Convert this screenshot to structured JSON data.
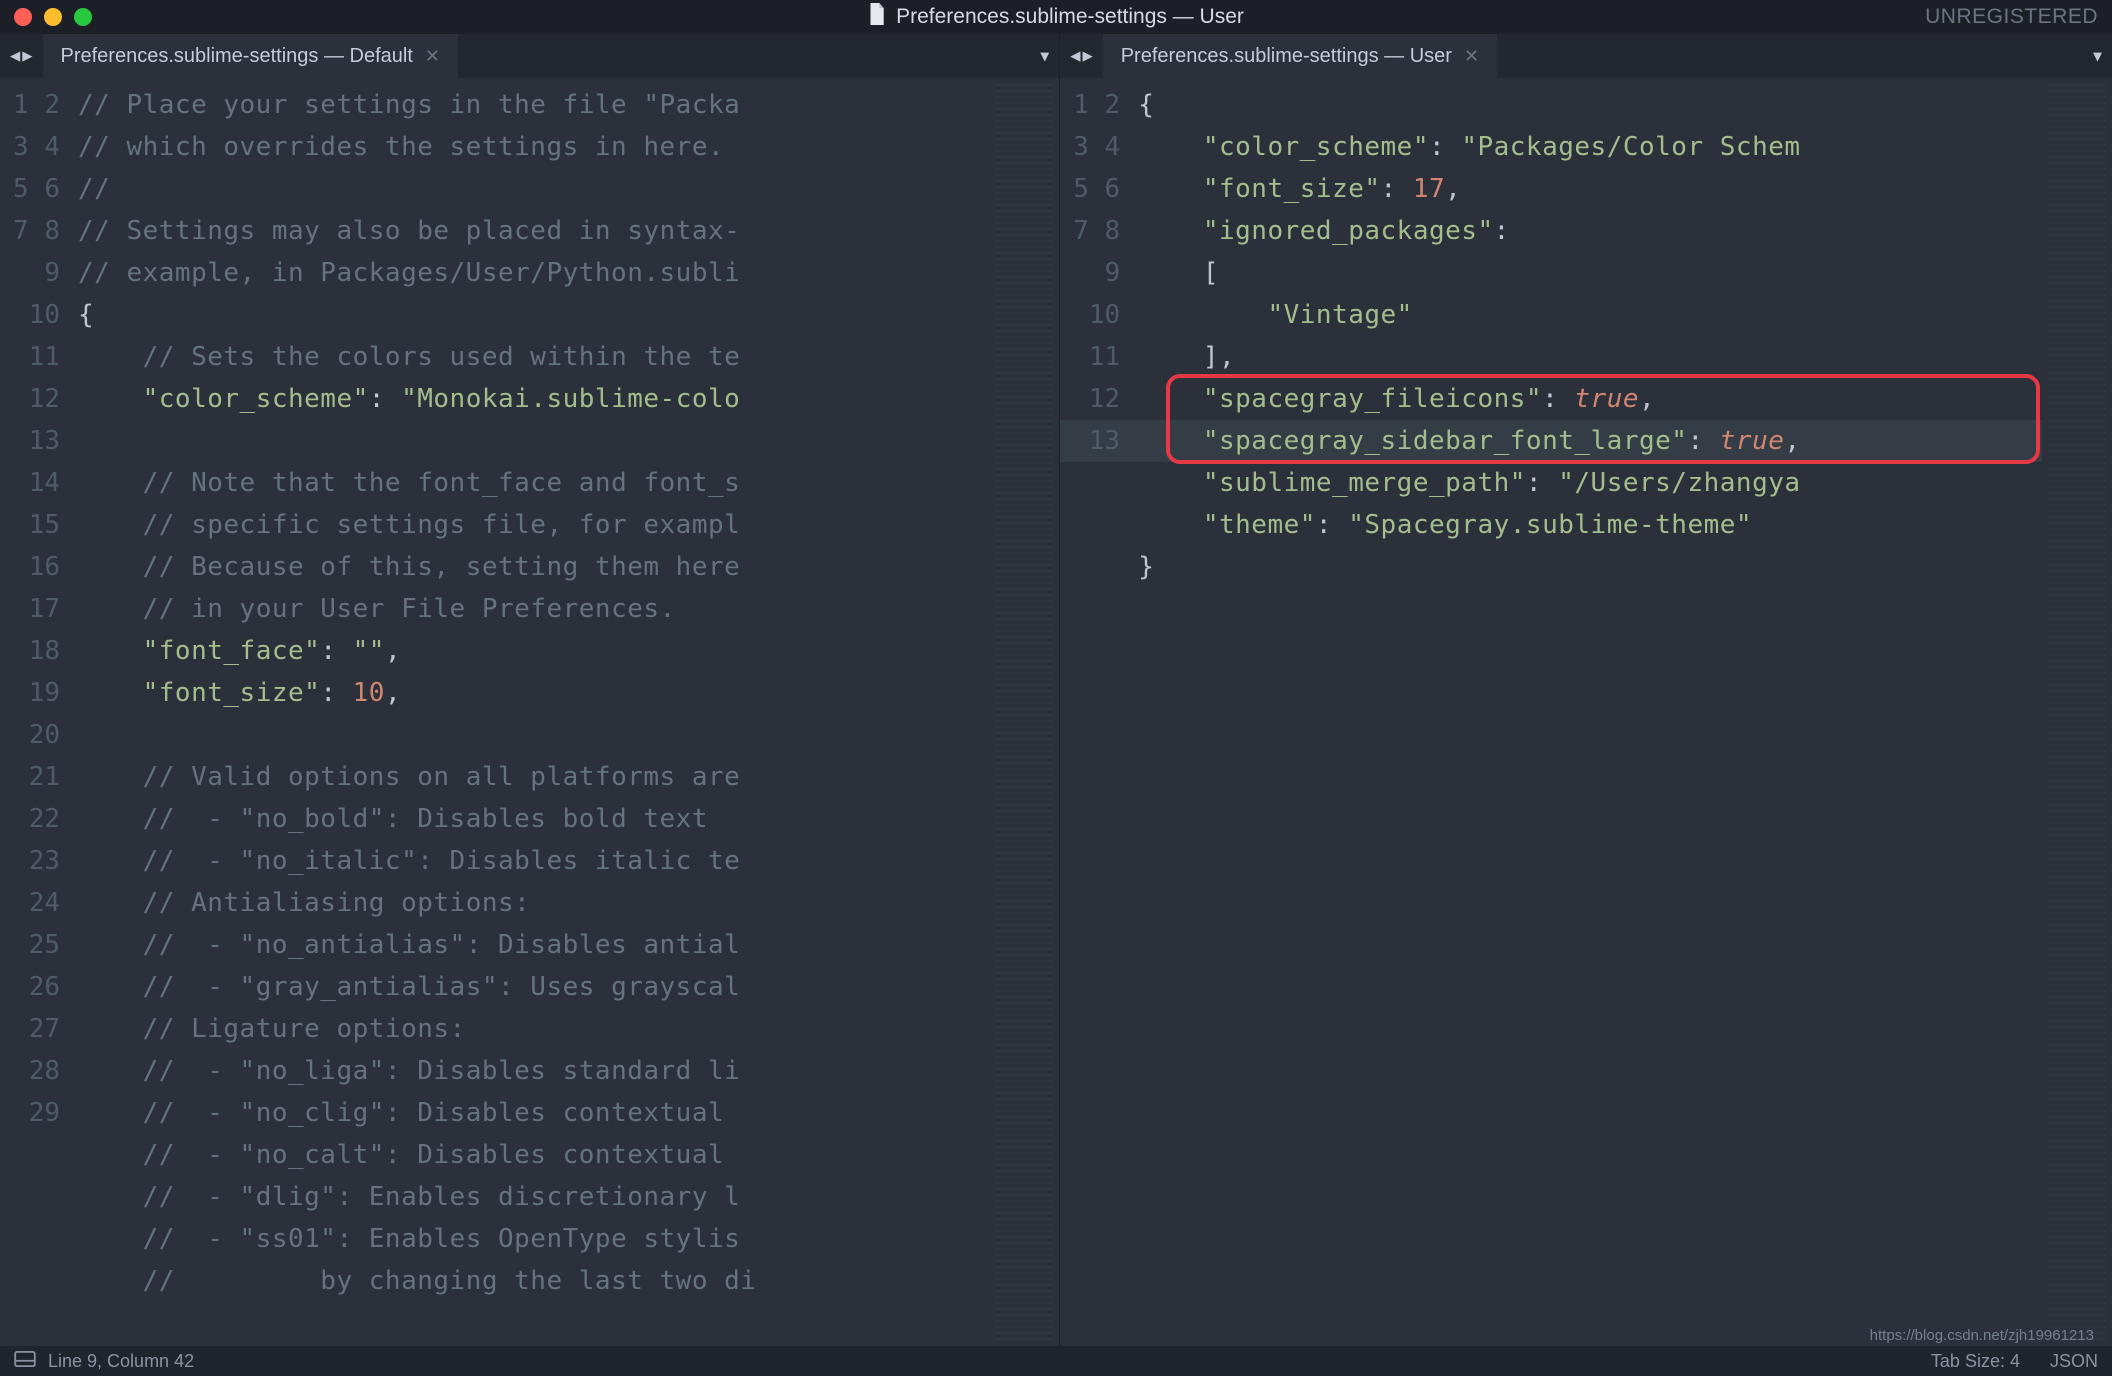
{
  "window": {
    "title": "Preferences.sublime-settings — User",
    "unregistered": "UNREGISTERED"
  },
  "panes": {
    "left": {
      "tab_label": "Preferences.sublime-settings — Default",
      "lines": [
        {
          "n": 1,
          "cm": "// Place your settings in the file \"Packa"
        },
        {
          "n": 2,
          "cm": "// which overrides the settings in here."
        },
        {
          "n": 3,
          "cm": "//"
        },
        {
          "n": 4,
          "cm": "// Settings may also be placed in syntax-"
        },
        {
          "n": 5,
          "cm": "// example, in Packages/User/Python.subli"
        },
        {
          "n": 6,
          "brace": "{"
        },
        {
          "n": 7,
          "indent": 1,
          "cm": "// Sets the colors used within the te"
        },
        {
          "n": 8,
          "indent": 1,
          "kv": {
            "k": "\"color_scheme\"",
            "v": "\"Monokai.sublime-colo",
            "vtype": "str"
          }
        },
        {
          "n": 9,
          "blank": true
        },
        {
          "n": 10,
          "indent": 1,
          "cm": "// Note that the font_face and font_s"
        },
        {
          "n": 11,
          "indent": 1,
          "cm": "// specific settings file, for exampl"
        },
        {
          "n": 12,
          "indent": 1,
          "cm": "// Because of this, setting them here"
        },
        {
          "n": 13,
          "indent": 1,
          "cm": "// in your User File Preferences."
        },
        {
          "n": 14,
          "indent": 1,
          "kv": {
            "k": "\"font_face\"",
            "v": "\"\"",
            "vtype": "str",
            "comma": true
          }
        },
        {
          "n": 15,
          "indent": 1,
          "kv": {
            "k": "\"font_size\"",
            "v": "10",
            "vtype": "num",
            "comma": true
          }
        },
        {
          "n": 16,
          "blank": true
        },
        {
          "n": 17,
          "indent": 1,
          "cm": "// Valid options on all platforms are"
        },
        {
          "n": 18,
          "indent": 1,
          "cm": "//  - \"no_bold\": Disables bold text"
        },
        {
          "n": 19,
          "indent": 1,
          "cm": "//  - \"no_italic\": Disables italic te"
        },
        {
          "n": 20,
          "indent": 1,
          "cm": "// Antialiasing options:"
        },
        {
          "n": 21,
          "indent": 1,
          "cm": "//  - \"no_antialias\": Disables antial"
        },
        {
          "n": 22,
          "indent": 1,
          "cm": "//  - \"gray_antialias\": Uses grayscal"
        },
        {
          "n": 23,
          "indent": 1,
          "cm": "// Ligature options:"
        },
        {
          "n": 24,
          "indent": 1,
          "cm": "//  - \"no_liga\": Disables standard li"
        },
        {
          "n": 25,
          "indent": 1,
          "cm": "//  - \"no_clig\": Disables contextual "
        },
        {
          "n": 26,
          "indent": 1,
          "cm": "//  - \"no_calt\": Disables contextual "
        },
        {
          "n": 27,
          "indent": 1,
          "cm": "//  - \"dlig\": Enables discretionary l"
        },
        {
          "n": 28,
          "indent": 1,
          "cm": "//  - \"ss01\": Enables OpenType stylis"
        },
        {
          "n": 29,
          "indent": 1,
          "cm": "//         by changing the last two di"
        }
      ]
    },
    "right": {
      "tab_label": "Preferences.sublime-settings — User",
      "current_line": 9,
      "highlight_lines": [
        8,
        9
      ],
      "lines": [
        {
          "n": 1,
          "brace": "{"
        },
        {
          "n": 2,
          "indent": 1,
          "kv": {
            "k": "\"color_scheme\"",
            "v": "\"Packages/Color Schem",
            "vtype": "str"
          }
        },
        {
          "n": 3,
          "indent": 1,
          "kv": {
            "k": "\"font_size\"",
            "v": "17",
            "vtype": "num",
            "comma": true
          }
        },
        {
          "n": 4,
          "indent": 1,
          "kv": {
            "k": "\"ignored_packages\"",
            "v": "",
            "vtype": "none"
          }
        },
        {
          "n": 5,
          "indent": 1,
          "raw": "["
        },
        {
          "n": 6,
          "indent": 2,
          "strval": "\"Vintage\""
        },
        {
          "n": 7,
          "indent": 1,
          "raw": "],"
        },
        {
          "n": 8,
          "indent": 1,
          "kv": {
            "k": "\"spacegray_fileicons\"",
            "v": "true",
            "vtype": "bool",
            "comma": true
          }
        },
        {
          "n": 9,
          "indent": 1,
          "kv": {
            "k": "\"spacegray_sidebar_font_large\"",
            "v": "true",
            "vtype": "bool",
            "comma": true
          }
        },
        {
          "n": 10,
          "indent": 1,
          "kv": {
            "k": "\"sublime_merge_path\"",
            "v": "\"/Users/zhangya",
            "vtype": "str"
          }
        },
        {
          "n": 11,
          "indent": 1,
          "kv": {
            "k": "\"theme\"",
            "v": "\"Spacegray.sublime-theme\"",
            "vtype": "str"
          }
        },
        {
          "n": 12,
          "brace": "}"
        },
        {
          "n": 13,
          "blank": true
        }
      ]
    }
  },
  "status": {
    "position": "Line 9, Column 42",
    "tab_size": "Tab Size: 4",
    "syntax": "JSON"
  },
  "watermark": "https://blog.csdn.net/zjh19961213"
}
